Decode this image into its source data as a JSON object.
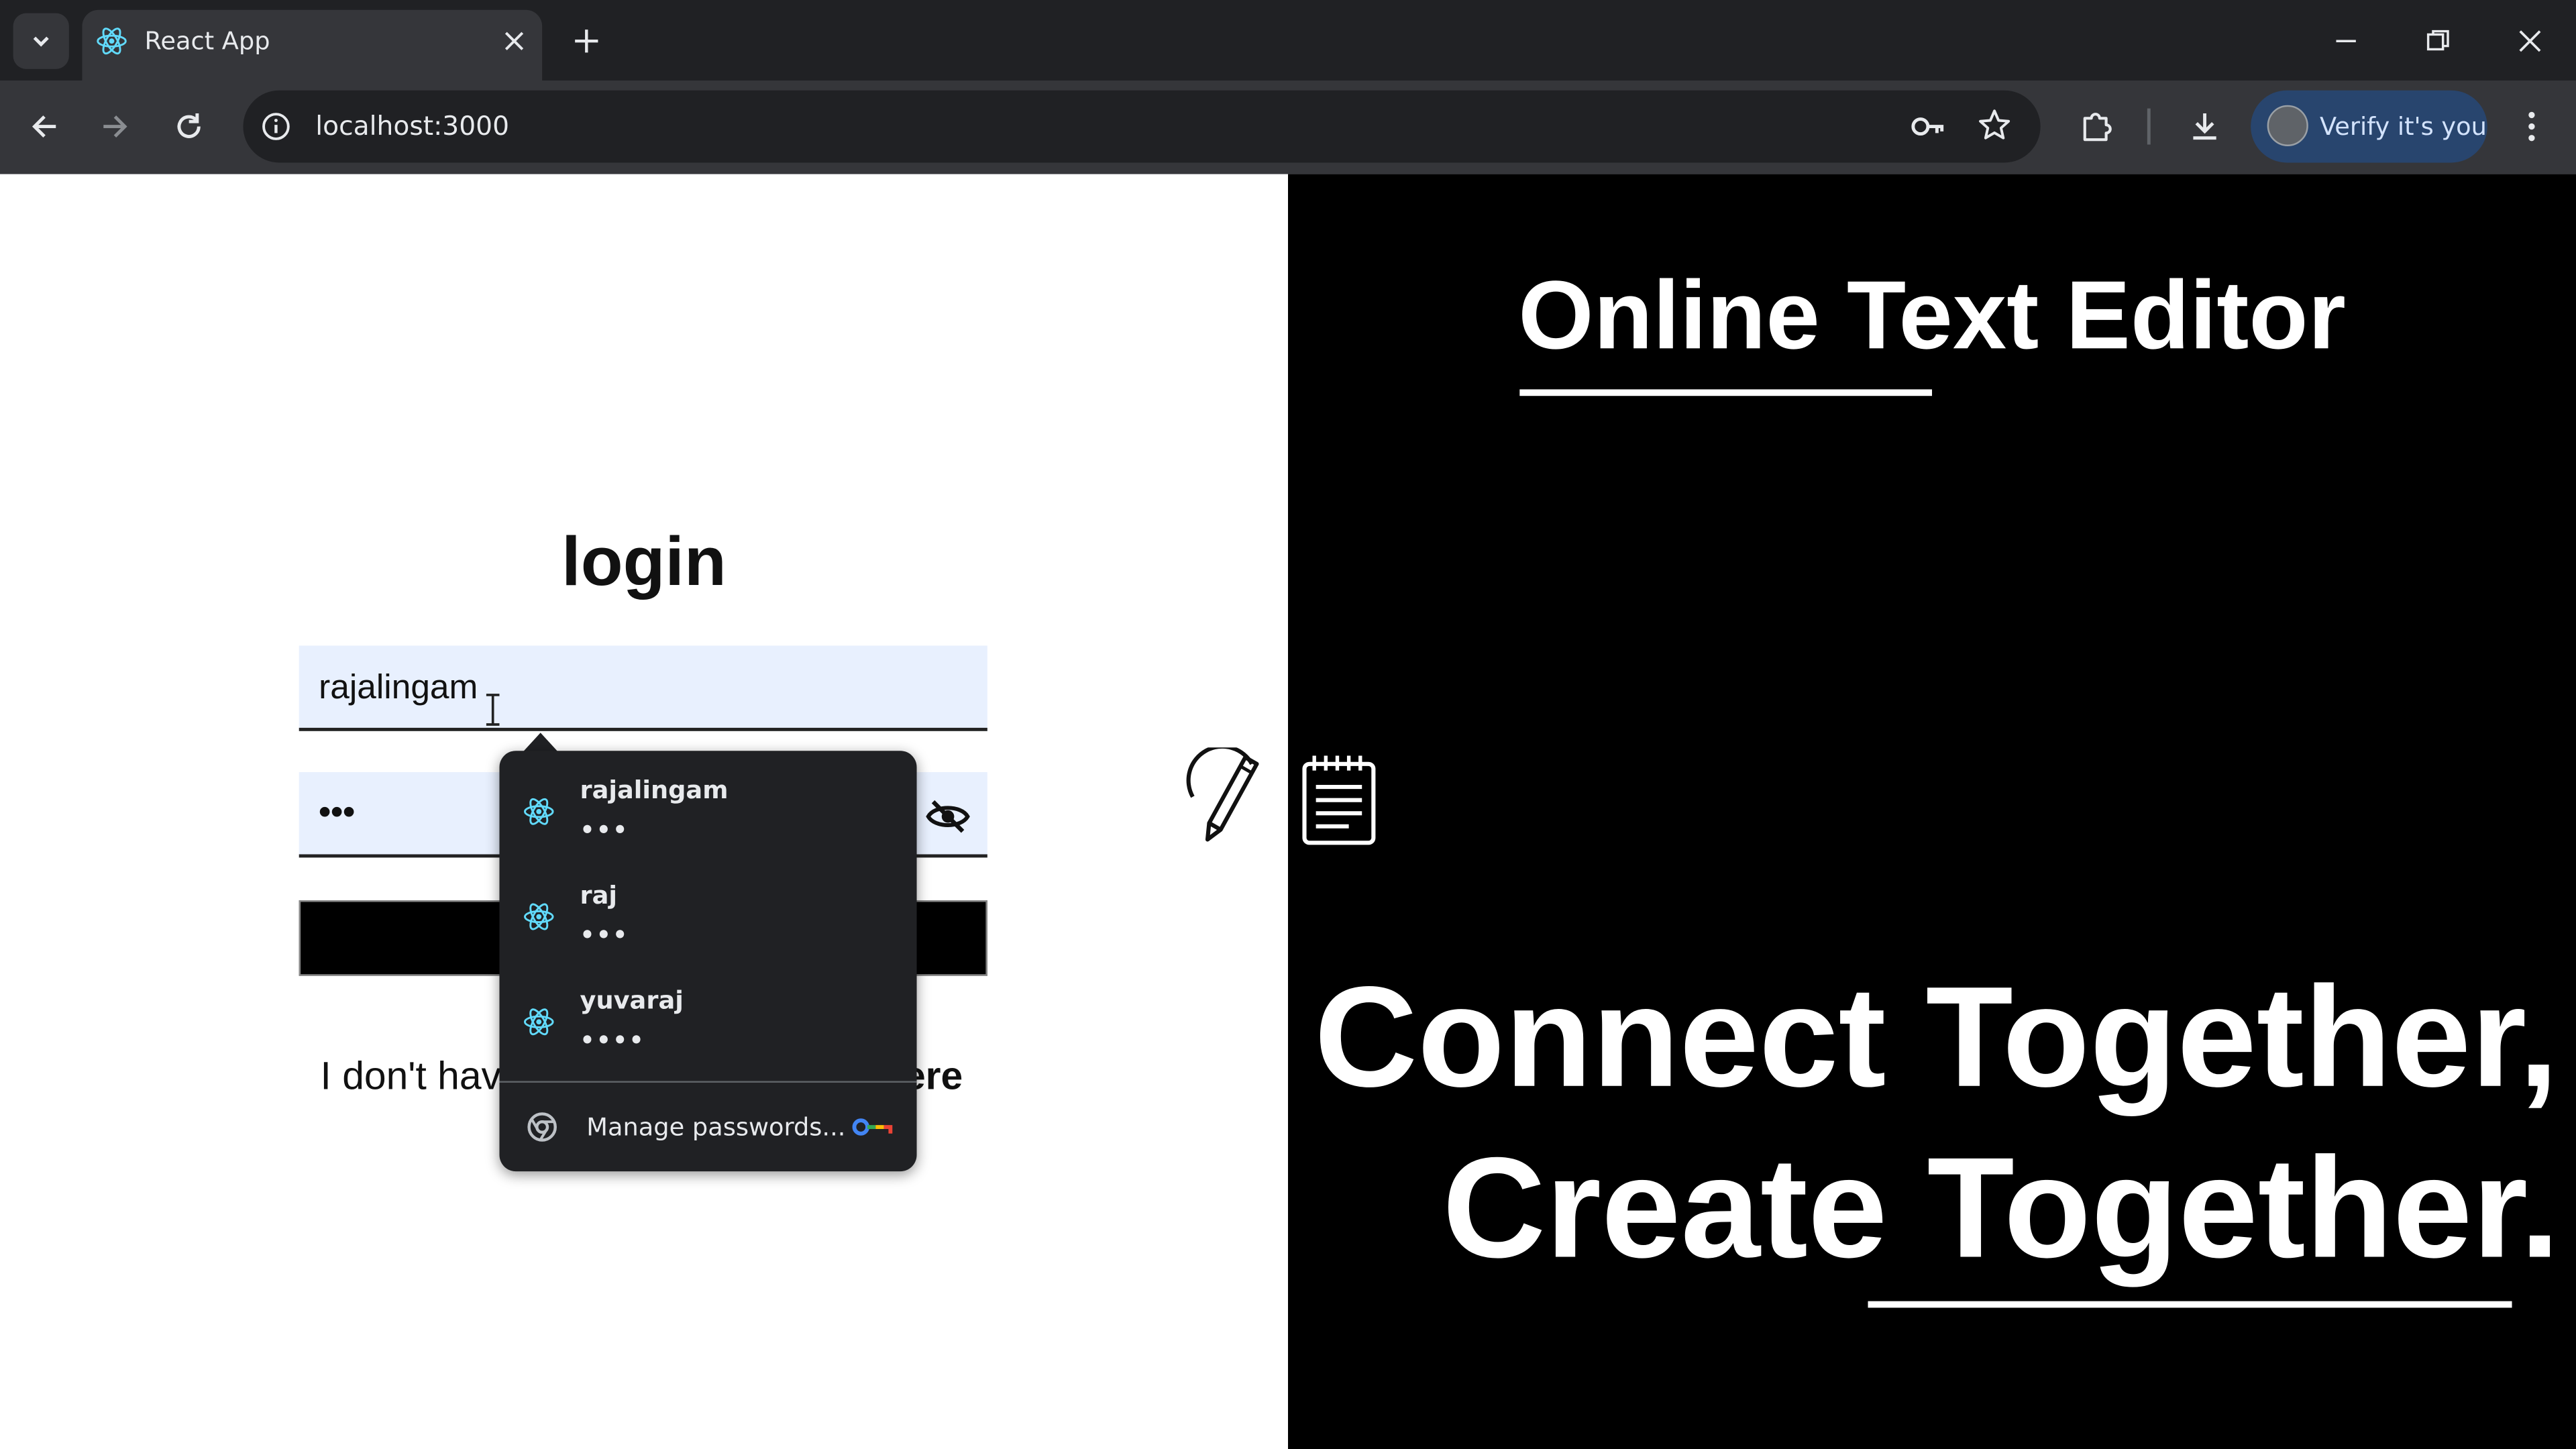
{
  "browser": {
    "tab_title": "React App",
    "url": "localhost:3000",
    "profile_button_label": "Verify it's you",
    "accent_color": "#28456e"
  },
  "login": {
    "title": "login",
    "username_value": "rajalingam",
    "password_value": "•••",
    "signup_prefix": "I don't hav",
    "signup_link_suffix": "ere"
  },
  "hero": {
    "title": "Online Text Editor",
    "line1": "Connect Together,",
    "line2": "Create Together."
  },
  "autofill": {
    "credentials": [
      {
        "username": "rajalingam",
        "password_mask": "•••"
      },
      {
        "username": "raj",
        "password_mask": "•••"
      },
      {
        "username": "yuvaraj",
        "password_mask": "••••"
      }
    ],
    "manage_label": "Manage passwords..."
  },
  "icons": {
    "tab_search": "chevron-down-icon",
    "favicon": "react-icon",
    "close_tab": "close-icon",
    "new_tab": "plus-icon",
    "back": "arrow-left-icon",
    "forward": "arrow-right-icon",
    "reload": "reload-icon",
    "site_info": "info-icon",
    "password_key": "key-icon",
    "bookmark": "star-icon",
    "extensions": "puzzle-icon",
    "downloads": "download-icon",
    "menu": "kebab-icon",
    "toggle_password": "eye-off-icon",
    "pencil": "pencil-icon",
    "notepad": "notepad-icon"
  }
}
